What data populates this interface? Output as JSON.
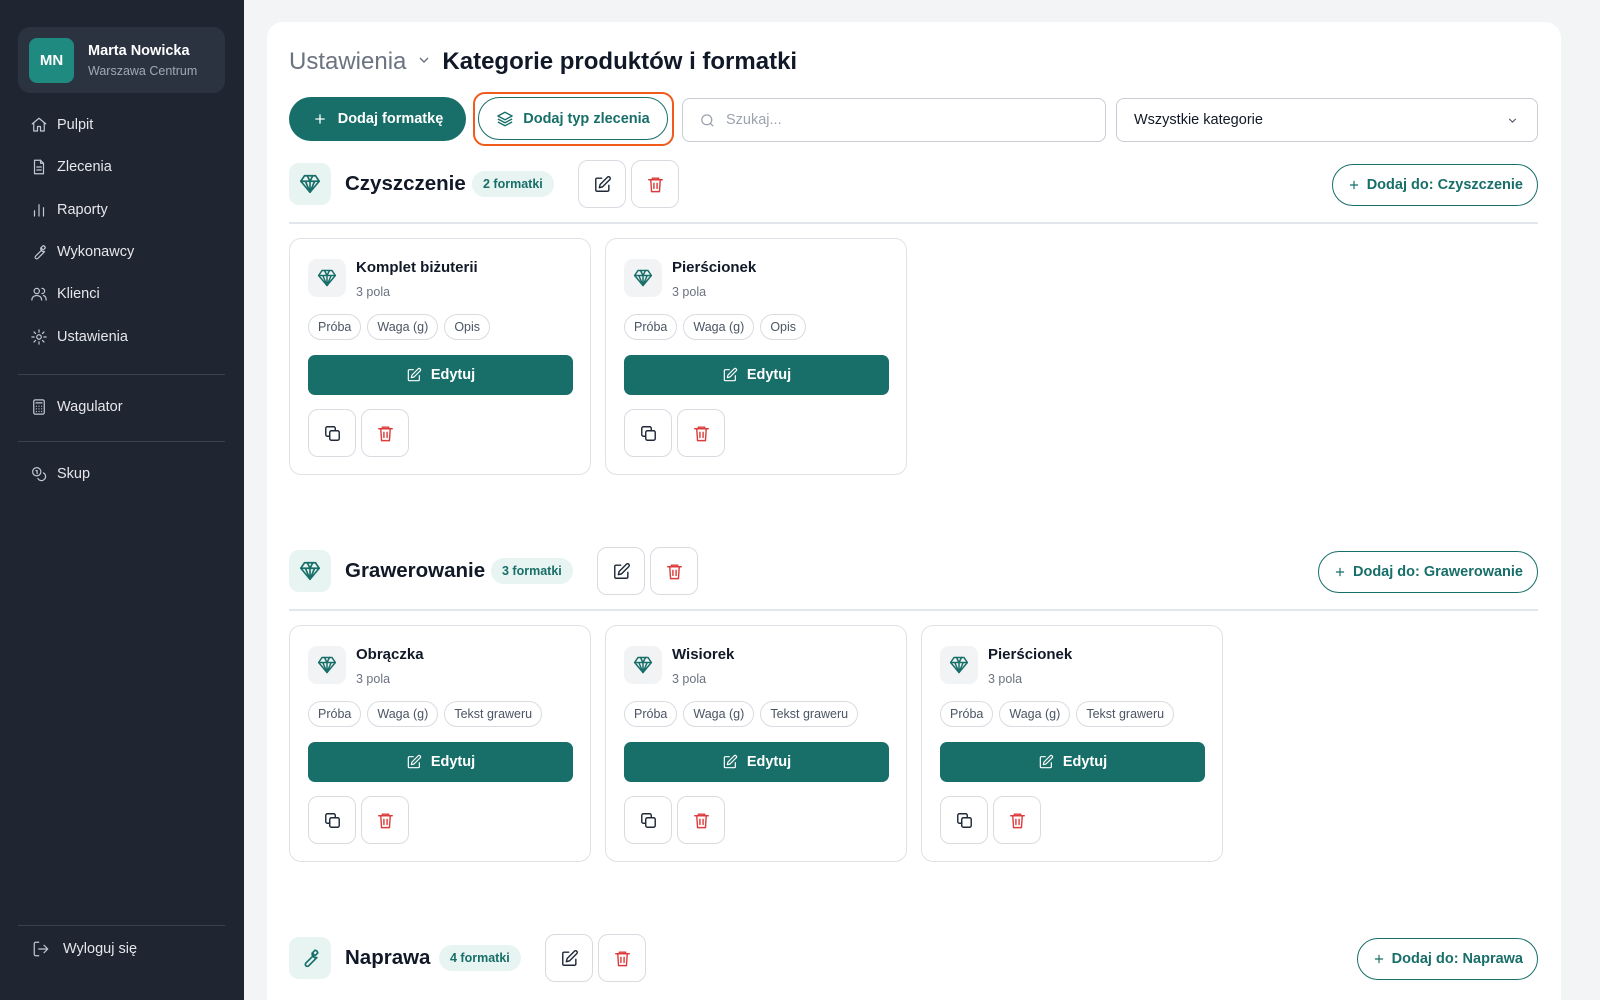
{
  "user": {
    "initials": "MN",
    "name": "Marta Nowicka",
    "location": "Warszawa Centrum"
  },
  "nav": [
    {
      "label": "Pulpit",
      "icon": "home-icon"
    },
    {
      "label": "Zlecenia",
      "icon": "document-icon"
    },
    {
      "label": "Raporty",
      "icon": "bar-chart-icon"
    },
    {
      "label": "Wykonawcy",
      "icon": "wrench-icon"
    },
    {
      "label": "Klienci",
      "icon": "users-icon"
    },
    {
      "label": "Ustawienia",
      "icon": "gear-icon"
    }
  ],
  "tools": [
    {
      "label": "Wagulator",
      "icon": "calculator-icon"
    },
    {
      "label": "Skup",
      "icon": "coins-icon"
    }
  ],
  "logout": {
    "label": "Wyloguj się",
    "icon": "logout-icon"
  },
  "breadcrumb": {
    "parent": "Ustawienia",
    "title": "Kategorie produktów i formatki"
  },
  "toolbar": {
    "add_template": "Dodaj formatkę",
    "add_order_type": "Dodaj typ zlecenia",
    "search_placeholder": "Szukaj...",
    "category_filter": "Wszystkie kategorie"
  },
  "colors": {
    "accent": "#186e68",
    "danger": "#dc3c3c",
    "highlight": "#f05a1a",
    "sidebar": "#1f2531"
  },
  "sections": [
    {
      "title": "Czyszczenie",
      "icon": "diamond-icon",
      "badge": "2 formatki",
      "add_label": "Dodaj do: Czyszczenie",
      "cards": [
        {
          "title": "Komplet biżuterii",
          "fields": "3 pola",
          "chips": [
            "Próba",
            "Waga (g)",
            "Opis"
          ],
          "edit": "Edytuj"
        },
        {
          "title": "Pierścionek",
          "fields": "3 pola",
          "chips": [
            "Próba",
            "Waga (g)",
            "Opis"
          ],
          "edit": "Edytuj"
        }
      ]
    },
    {
      "title": "Grawerowanie",
      "icon": "diamond-icon",
      "badge": "3 formatki",
      "add_label": "Dodaj do: Grawerowanie",
      "cards": [
        {
          "title": "Obrączka",
          "fields": "3 pola",
          "chips": [
            "Próba",
            "Waga (g)",
            "Tekst graweru"
          ],
          "edit": "Edytuj"
        },
        {
          "title": "Wisiorek",
          "fields": "3 pola",
          "chips": [
            "Próba",
            "Waga (g)",
            "Tekst graweru"
          ],
          "edit": "Edytuj"
        },
        {
          "title": "Pierścionek",
          "fields": "3 pola",
          "chips": [
            "Próba",
            "Waga (g)",
            "Tekst graweru"
          ],
          "edit": "Edytuj"
        }
      ]
    },
    {
      "title": "Naprawa",
      "icon": "wrench-icon",
      "badge": "4 formatki",
      "add_label": "Dodaj do: Naprawa",
      "cards": []
    }
  ]
}
